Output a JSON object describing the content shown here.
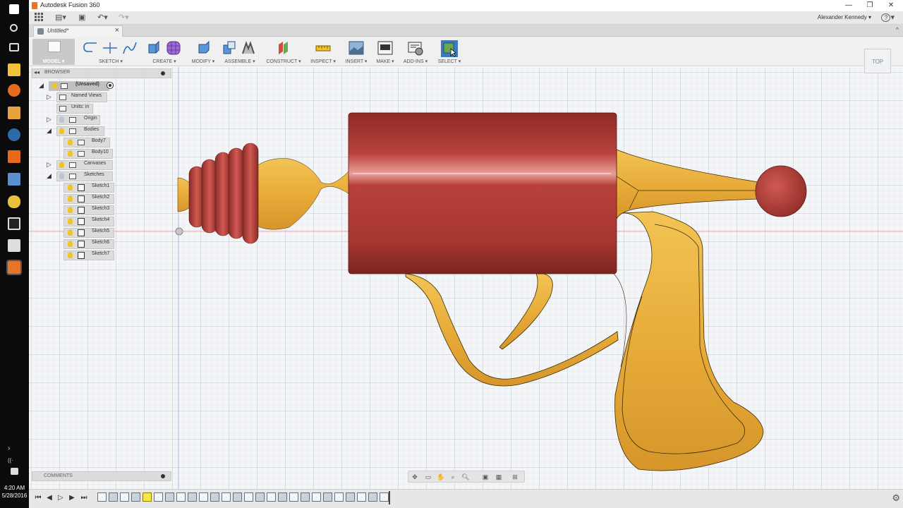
{
  "window": {
    "app_title": "Autodesk Fusion 360",
    "min": "—",
    "restore": "❐",
    "close": "✕"
  },
  "qat": {
    "grid_icon": "grid-icon",
    "file_icon": "file-icon",
    "save_icon": "save-icon",
    "undo_icon": "undo-icon",
    "redo_icon": "redo-icon",
    "user_name": "Alexander Kennedy",
    "help": "?"
  },
  "doc_tab": {
    "label": "Untitled*",
    "close": "×"
  },
  "toolbar": {
    "workspace": "MODEL",
    "groups": [
      {
        "label": "SKETCH"
      },
      {
        "label": "CREATE"
      },
      {
        "label": "MODIFY"
      },
      {
        "label": "ASSEMBLE"
      },
      {
        "label": "CONSTRUCT"
      },
      {
        "label": "INSPECT"
      },
      {
        "label": "INSERT"
      },
      {
        "label": "MAKE"
      },
      {
        "label": "ADD-INS"
      },
      {
        "label": "SELECT"
      }
    ]
  },
  "browser": {
    "title": "BROWSER",
    "nodes": [
      {
        "label": "(Unsaved)"
      },
      {
        "label": "Named Views"
      },
      {
        "label": "Units: in"
      },
      {
        "label": "Origin"
      },
      {
        "label": "Bodies"
      },
      {
        "label": "Body7"
      },
      {
        "label": "Body10"
      },
      {
        "label": "Canvases"
      },
      {
        "label": "Sketches"
      },
      {
        "label": "Sketch1"
      },
      {
        "label": "Sketch2"
      },
      {
        "label": "Sketch3"
      },
      {
        "label": "Sketch4"
      },
      {
        "label": "Sketch5"
      },
      {
        "label": "Sketch6"
      },
      {
        "label": "Sketch7"
      }
    ]
  },
  "comments": {
    "title": "COMMENTS"
  },
  "viewcube": {
    "face": "TOP"
  },
  "taskbar": {
    "time": "4:20 AM",
    "date": "5/28/2016"
  },
  "colors": {
    "accent": "#3a7bbf",
    "body_red": "#b8423b",
    "body_yellow": "#e8ac3a",
    "canvas_bg": "#f4f5f7"
  }
}
